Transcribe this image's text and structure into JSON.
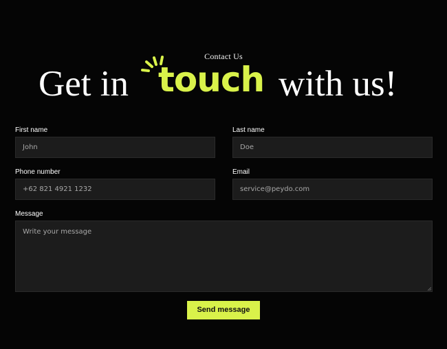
{
  "header": {
    "eyebrow": "Contact Us",
    "headline_before": "Get in",
    "headline_accent": "touch",
    "headline_after": "with us!"
  },
  "form": {
    "first_name": {
      "label": "First name",
      "placeholder": "John"
    },
    "last_name": {
      "label": "Last name",
      "placeholder": "Doe"
    },
    "phone": {
      "label": "Phone number",
      "placeholder": "+62 821 4921 1232"
    },
    "email": {
      "label": "Email",
      "placeholder": "service@peydo.com"
    },
    "message": {
      "label": "Message",
      "placeholder": "Write your message"
    },
    "submit_label": "Send message"
  },
  "colors": {
    "accent": "#d9f24a",
    "background": "#050505",
    "field_background": "#1c1c1c"
  },
  "icons": {
    "headline_decoration": "sparkle-lines-icon"
  }
}
